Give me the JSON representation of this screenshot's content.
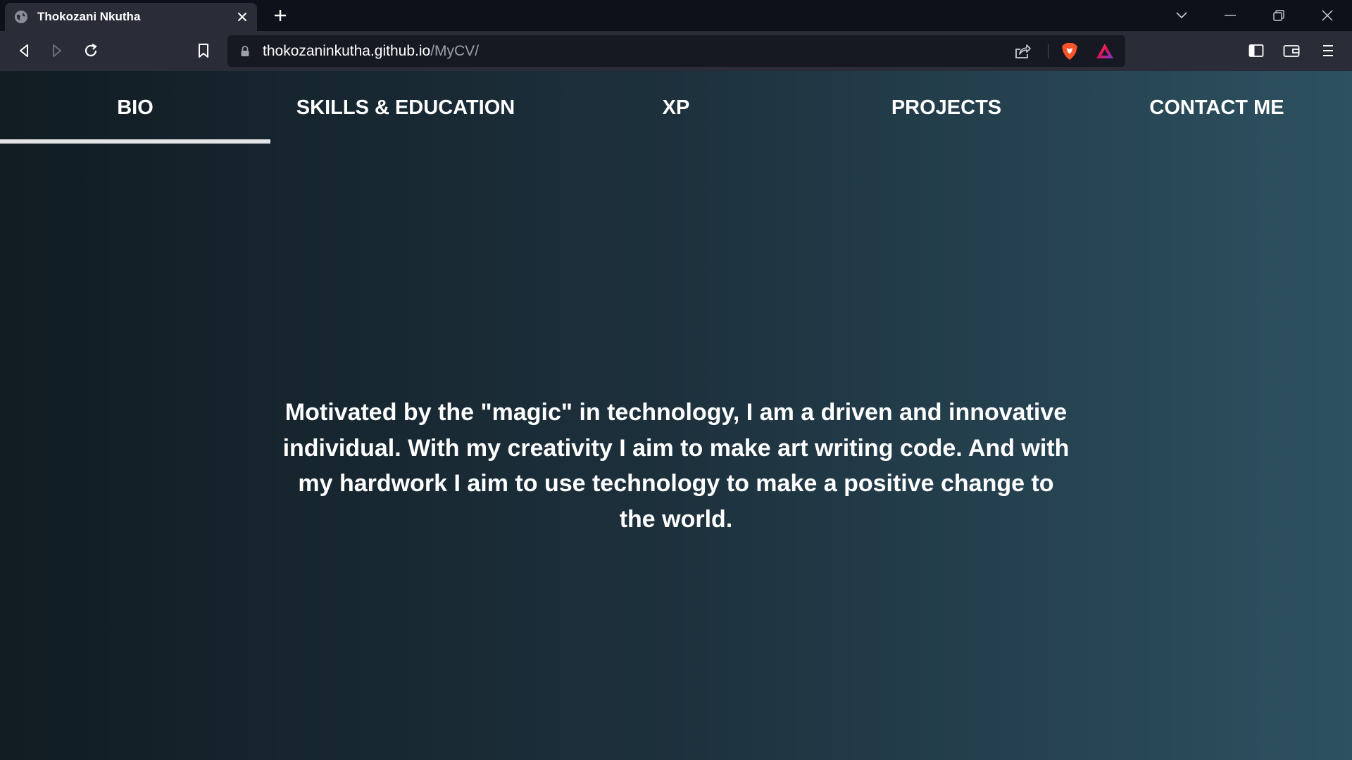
{
  "browser": {
    "tab": {
      "title": "Thokozani Nkutha",
      "favicon": "globe-icon"
    },
    "url": {
      "host": "thokozaninkutha.github.io",
      "path": "/MyCV/"
    },
    "icons": {
      "back": "back-arrow-icon",
      "forward": "forward-arrow-icon",
      "reload": "reload-icon",
      "bookmark": "bookmark-icon",
      "lock": "lock-icon",
      "share": "share-icon",
      "shields": "brave-shields-icon",
      "rewards": "brave-rewards-icon",
      "sidebar": "sidebar-icon",
      "wallet": "wallet-icon",
      "menu": "menu-icon"
    }
  },
  "nav": {
    "tabs": [
      "BIO",
      "SKILLS & EDUCATION",
      "XP",
      "PROJECTS",
      "CONTACT ME"
    ],
    "active": "BIO"
  },
  "bio": {
    "text": "Motivated by the \"magic\" in technology, I am a driven and innovative individual. With my creativity I aim to make art writing code. And with my hardwork I aim to use technology to make a positive change to the world."
  },
  "colors": {
    "chrome_dark": "#0e1119",
    "chrome_toolbar": "#2a2d38",
    "page_gradient_start": "#111c23",
    "page_gradient_end": "#2d5161",
    "brave_orange": "#fb542b"
  }
}
